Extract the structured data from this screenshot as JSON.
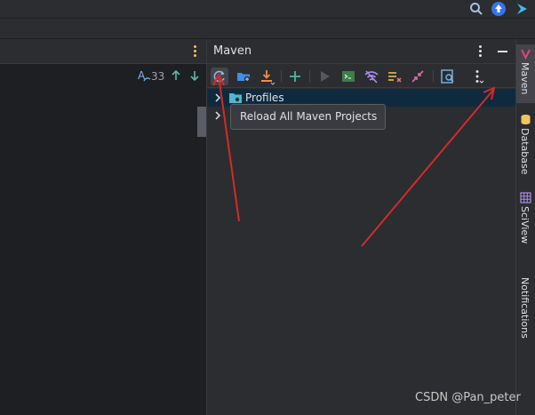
{
  "top_toolbar": {
    "icons": [
      "search-icon",
      "update-icon",
      "plugin-icon"
    ]
  },
  "editor": {
    "find_count": "33",
    "find_icon": "regex-icon"
  },
  "maven": {
    "title": "Maven",
    "toolbar_icons": [
      "reload-icon",
      "add-folder-icon",
      "download-icon",
      "plus-icon",
      "run-icon",
      "execute-goal-icon",
      "toggle-offline-icon",
      "skip-tests-icon",
      "collapse-all-icon",
      "analyze-dependencies-icon",
      "more-icon"
    ],
    "tree": [
      {
        "label": "Profiles",
        "icon": "profiles-folder-icon",
        "selected": true
      },
      {
        "label": "",
        "icon": "project-icon",
        "selected": false
      }
    ],
    "tooltip": "Reload All Maven Projects"
  },
  "right_strip": {
    "tabs": [
      {
        "label": "Maven",
        "icon": "maven-icon",
        "active": true
      },
      {
        "label": "Database",
        "icon": "database-icon",
        "active": false
      },
      {
        "label": "SciView",
        "icon": "sciview-icon",
        "active": false
      },
      {
        "label": "Notifications",
        "icon": "notifications-icon",
        "active": false
      }
    ]
  },
  "watermark": "CSDN @Pan_peter",
  "colors": {
    "accent": "#3574f0",
    "annotation_arrow": "#d42a2a",
    "selection": "#0f2a3f",
    "background": "#2b2d30"
  }
}
